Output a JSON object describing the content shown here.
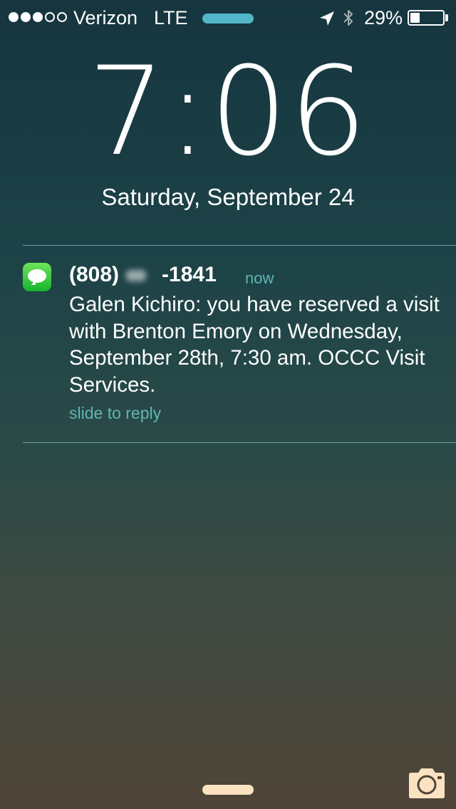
{
  "status_bar": {
    "signal_bars": 3,
    "signal_total": 5,
    "carrier": "Verizon",
    "network": "LTE",
    "location_icon": "location-arrow-icon",
    "bluetooth_icon": "bluetooth-icon",
    "battery_percent": "29%",
    "battery_level": 0.29
  },
  "lock_screen": {
    "time": "7:06",
    "date": "Saturday, September 24"
  },
  "notification": {
    "app_icon": "messages-icon",
    "sender_prefix": "(808)",
    "sender_suffix": "-1841",
    "time": "now",
    "body": "Galen Kichiro: you have reserved a visit with Brenton Emory on Wednesday, September 28th, 7:30 am. OCCC Visit Services.",
    "action_hint": "slide to reply"
  },
  "bottom": {
    "camera_icon": "camera-icon"
  },
  "colors": {
    "accent": "#5fb6b3",
    "call_pill": "#52b6c9",
    "messages_green": "#1fbf35",
    "home_indicator": "#fbe2c0",
    "camera": "#fbe2c0"
  }
}
